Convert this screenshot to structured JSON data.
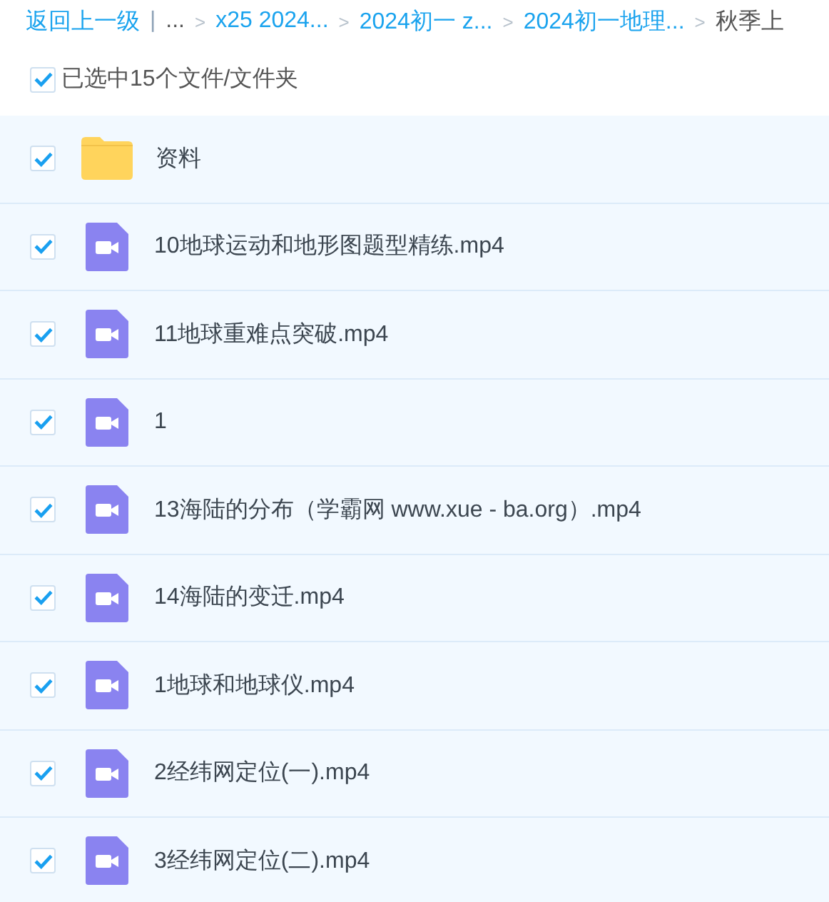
{
  "breadcrumb": {
    "back": "返回上一级",
    "divider": "|",
    "items": [
      {
        "label": "...",
        "kind": "ellipsis"
      },
      {
        "label": "x25 2024...",
        "kind": "link"
      },
      {
        "label": "2024初一 z...",
        "kind": "link"
      },
      {
        "label": "2024初一地理...",
        "kind": "link"
      },
      {
        "label": "秋季上",
        "kind": "current"
      }
    ],
    "separator": ">"
  },
  "selection": {
    "checked": true,
    "label": "已选中15个文件/文件夹"
  },
  "files": [
    {
      "kind": "folder",
      "name": "资料",
      "checked": true
    },
    {
      "kind": "video",
      "name": "10地球运动和地形图题型精练.mp4",
      "checked": true
    },
    {
      "kind": "video",
      "name": "11地球重难点突破.mp4",
      "checked": true
    },
    {
      "kind": "video",
      "name": "1",
      "checked": true
    },
    {
      "kind": "video",
      "name": "13海陆的分布（学霸网 www.xue - ba.org）.mp4",
      "checked": true
    },
    {
      "kind": "video",
      "name": "14海陆的变迁.mp4",
      "checked": true
    },
    {
      "kind": "video",
      "name": "1地球和地球仪.mp4",
      "checked": true
    },
    {
      "kind": "video",
      "name": "2经纬网定位(一).mp4",
      "checked": true
    },
    {
      "kind": "video",
      "name": "3经纬网定位(二).mp4",
      "checked": true
    }
  ]
}
